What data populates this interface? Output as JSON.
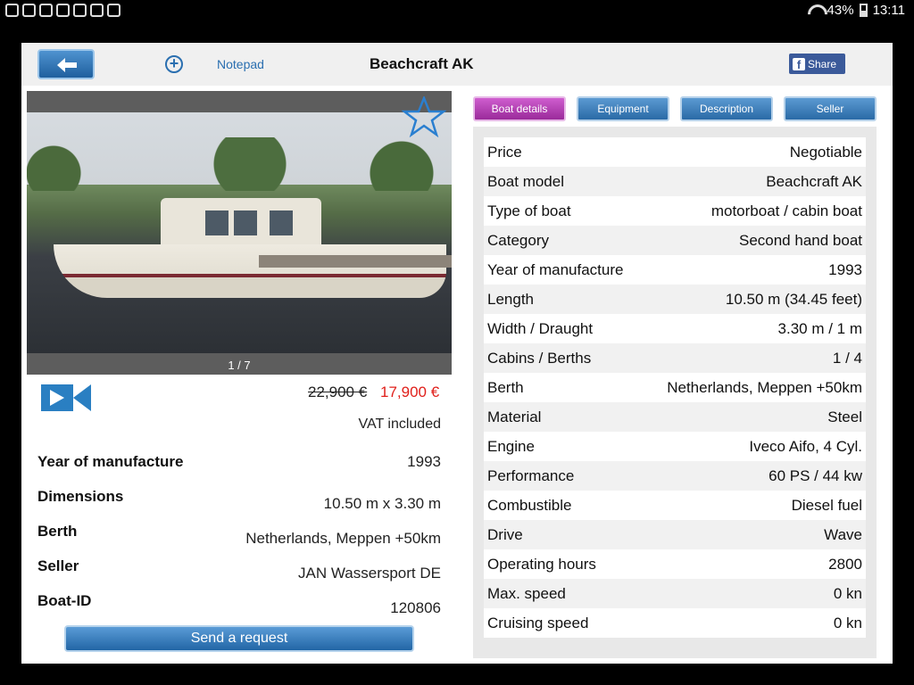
{
  "status_bar": {
    "battery": "43%",
    "time": "13:11"
  },
  "topbar": {
    "notepad_label": "Notepad",
    "title": "Beachcraft AK",
    "share_label": "Share"
  },
  "gallery": {
    "counter": "1 / 7"
  },
  "price": {
    "old": "22,900 €",
    "new": "17,900 €",
    "vat": "VAT included"
  },
  "summary": [
    {
      "label": "Year of manufacture",
      "value": "1993"
    },
    {
      "label": "Dimensions",
      "value": "10.50 m x 3.30 m"
    },
    {
      "label": "Berth",
      "value": "Netherlands, Meppen +50km"
    },
    {
      "label": "Seller",
      "value": "JAN Wassersport DE"
    },
    {
      "label": "Boat-ID",
      "value": "120806"
    }
  ],
  "send_request_label": "Send a request",
  "tabs": [
    {
      "label": "Boat details",
      "active": true
    },
    {
      "label": "Equipment",
      "active": false
    },
    {
      "label": "Description",
      "active": false
    },
    {
      "label": "Seller",
      "active": false
    }
  ],
  "details": [
    {
      "label": "Price",
      "value": "Negotiable"
    },
    {
      "label": "Boat model",
      "value": "Beachcraft AK"
    },
    {
      "label": "Type of boat",
      "value": "motorboat / cabin boat"
    },
    {
      "label": "Category",
      "value": "Second hand boat"
    },
    {
      "label": "Year of manufacture",
      "value": "1993"
    },
    {
      "label": "Length",
      "value": "10.50 m (34.45 feet)"
    },
    {
      "label": "Width / Draught",
      "value": "3.30 m / 1 m"
    },
    {
      "label": "Cabins / Berths",
      "value": "1 / 4"
    },
    {
      "label": "Berth",
      "value": "Netherlands, Meppen +50km"
    },
    {
      "label": "Material",
      "value": "Steel"
    },
    {
      "label": "Engine",
      "value": "Iveco Aifo, 4 Cyl."
    },
    {
      "label": "Performance",
      "value": "60 PS / 44 kw"
    },
    {
      "label": "Combustible",
      "value": "Diesel fuel"
    },
    {
      "label": "Drive",
      "value": "Wave"
    },
    {
      "label": "Operating hours",
      "value": "2800"
    },
    {
      "label": "Max. speed",
      "value": "0 kn"
    },
    {
      "label": "Cruising speed",
      "value": "0 kn"
    }
  ],
  "colors": {
    "accent_blue": "#2a6fb0",
    "active_tab": "#b040b0",
    "sale_price": "#e0201b",
    "facebook": "#3b5a9a"
  }
}
